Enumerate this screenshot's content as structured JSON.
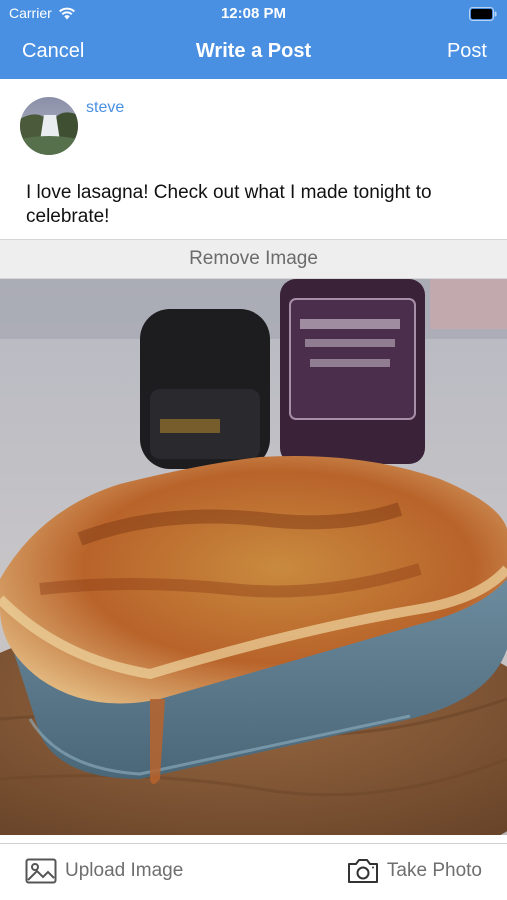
{
  "status_bar": {
    "carrier": "Carrier",
    "time": "12:08 PM"
  },
  "nav": {
    "cancel_label": "Cancel",
    "title": "Write a Post",
    "post_label": "Post"
  },
  "post": {
    "username": "steve",
    "text": "I love lasagna! Check out what I made tonight to celebrate!"
  },
  "image_actions": {
    "remove_label": "Remove Image"
  },
  "bottom_bar": {
    "upload_label": "Upload Image",
    "take_photo_label": "Take Photo"
  },
  "icons": [
    "wifi-icon",
    "battery-icon",
    "upload-image-icon",
    "camera-icon"
  ],
  "colors": {
    "accent": "#4a90e2",
    "remove_bar_bg": "#eeeeee",
    "muted_text": "#6e6e6e"
  }
}
